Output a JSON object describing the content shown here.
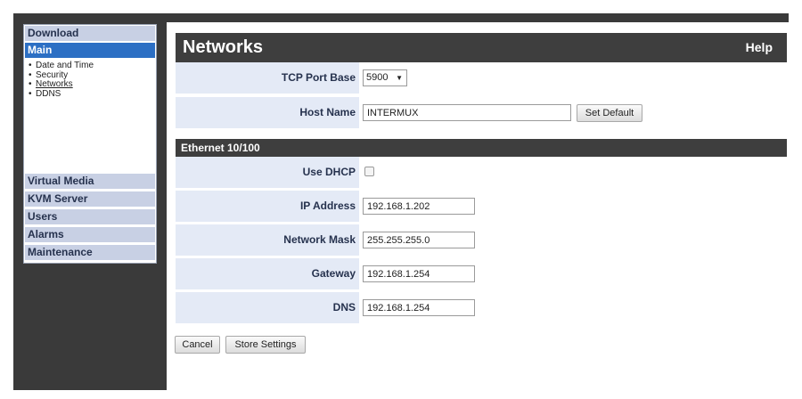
{
  "sidebar": {
    "download": "Download",
    "main": "Main",
    "sub_items": [
      "Date and Time",
      "Security",
      "Networks",
      "DDNS"
    ],
    "bullet": "•",
    "sections": [
      "Virtual Media",
      "KVM Server",
      "Users",
      "Alarms",
      "Maintenance"
    ]
  },
  "page": {
    "title": "Networks",
    "help": "Help"
  },
  "fields": {
    "tcp_port_base": {
      "label": "TCP Port Base",
      "value": "5900",
      "arrow": "▼"
    },
    "host_name": {
      "label": "Host Name",
      "value": "INTERMUX",
      "button": "Set Default"
    },
    "section_title": "Ethernet 10/100",
    "use_dhcp": {
      "label": "Use DHCP",
      "checked": false
    },
    "ip_address": {
      "label": "IP Address",
      "value": "192.168.1.202"
    },
    "network_mask": {
      "label": "Network Mask",
      "value": "255.255.255.0"
    },
    "gateway": {
      "label": "Gateway",
      "value": "192.168.1.254"
    },
    "dns": {
      "label": "DNS",
      "value": "192.168.1.254"
    }
  },
  "actions": {
    "cancel": "Cancel",
    "store": "Store Settings"
  },
  "colors": {
    "frame": "#3a3a3a",
    "active_nav": "#2c6fc4",
    "nav_section": "#c8d0e4",
    "label_cell": "#e4eaf6"
  }
}
